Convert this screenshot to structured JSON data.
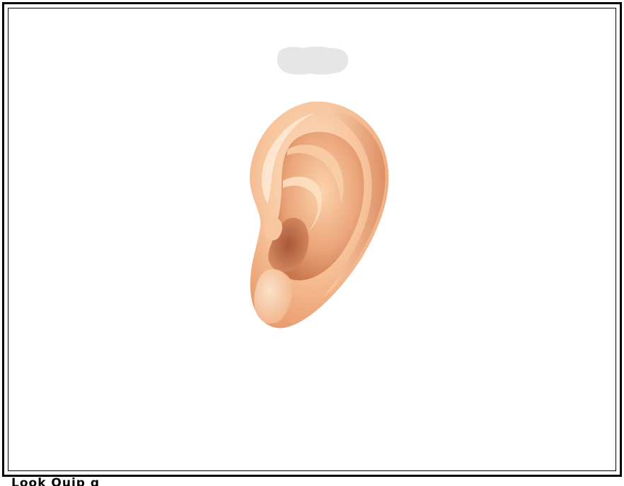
{
  "image": {
    "subject": "ear-illustration",
    "colors": {
      "frame": "#000000",
      "background": "#ffffff",
      "skin_light": "#fde0c2",
      "skin_mid": "#f5b98e",
      "skin_dark": "#c9764b",
      "redaction": "#e6e6e6"
    }
  },
  "footer": {
    "text": "Look Ouip g"
  }
}
